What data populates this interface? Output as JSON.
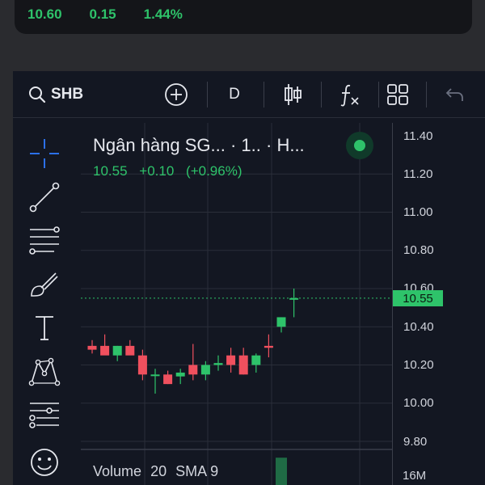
{
  "quote": {
    "last": "10.60",
    "change": "0.15",
    "change_pct": "1.44%"
  },
  "toolbar": {
    "symbol": "SHB",
    "interval": "D",
    "icons": [
      "search-icon",
      "add-icon",
      "candles-icon",
      "indicators-icon",
      "layout-icon",
      "undo-icon"
    ]
  },
  "tools": [
    "crosshair-icon",
    "trendline-icon",
    "fib-icon",
    "brush-icon",
    "text-icon",
    "pattern-icon",
    "forecast-icon",
    "emoji-icon"
  ],
  "legend": {
    "title": "Ngân hàng SG... · 1.. · H...",
    "price": "10.55",
    "change": "+0.10",
    "change_pct": "(+0.96%)"
  },
  "axis": {
    "ticks": [
      "11.40",
      "11.20",
      "11.00",
      "10.80",
      "10.60",
      "10.40",
      "10.20",
      "10.00",
      "9.80"
    ],
    "current_price": "10.55"
  },
  "volume": {
    "label": "Volume",
    "period": "20",
    "sma_label": "SMA 9",
    "tick": "16M"
  },
  "colors": {
    "up": "#2ec36a",
    "down": "#f0505e",
    "bg": "#131722",
    "grid": "#2a2e39"
  },
  "chart_data": {
    "type": "candlestick",
    "ylim": [
      9.8,
      11.4
    ],
    "candles": [
      {
        "o": 10.3,
        "h": 10.33,
        "l": 10.26,
        "c": 10.28
      },
      {
        "o": 10.3,
        "h": 10.36,
        "l": 10.26,
        "c": 10.25
      },
      {
        "o": 10.25,
        "h": 10.3,
        "l": 10.22,
        "c": 10.3
      },
      {
        "o": 10.3,
        "h": 10.33,
        "l": 10.26,
        "c": 10.25
      },
      {
        "o": 10.25,
        "h": 10.28,
        "l": 10.12,
        "c": 10.15
      },
      {
        "o": 10.15,
        "h": 10.18,
        "l": 10.05,
        "c": 10.15
      },
      {
        "o": 10.15,
        "h": 10.17,
        "l": 10.1,
        "c": 10.1
      },
      {
        "o": 10.14,
        "h": 10.18,
        "l": 10.1,
        "c": 10.16
      },
      {
        "o": 10.2,
        "h": 10.31,
        "l": 10.12,
        "c": 10.15
      },
      {
        "o": 10.15,
        "h": 10.22,
        "l": 10.12,
        "c": 10.2
      },
      {
        "o": 10.2,
        "h": 10.25,
        "l": 10.17,
        "c": 10.21
      },
      {
        "o": 10.25,
        "h": 10.29,
        "l": 10.16,
        "c": 10.2
      },
      {
        "o": 10.25,
        "h": 10.29,
        "l": 10.15,
        "c": 10.15
      },
      {
        "o": 10.2,
        "h": 10.26,
        "l": 10.16,
        "c": 10.25
      },
      {
        "o": 10.3,
        "h": 10.36,
        "l": 10.24,
        "c": 10.29
      },
      {
        "o": 10.4,
        "h": 10.45,
        "l": 10.37,
        "c": 10.45
      },
      {
        "o": 10.55,
        "h": 10.6,
        "l": 10.45,
        "c": 10.55
      }
    ],
    "volume_bars": [
      {
        "index": 15,
        "dir": "up",
        "value": 0.95
      }
    ]
  }
}
